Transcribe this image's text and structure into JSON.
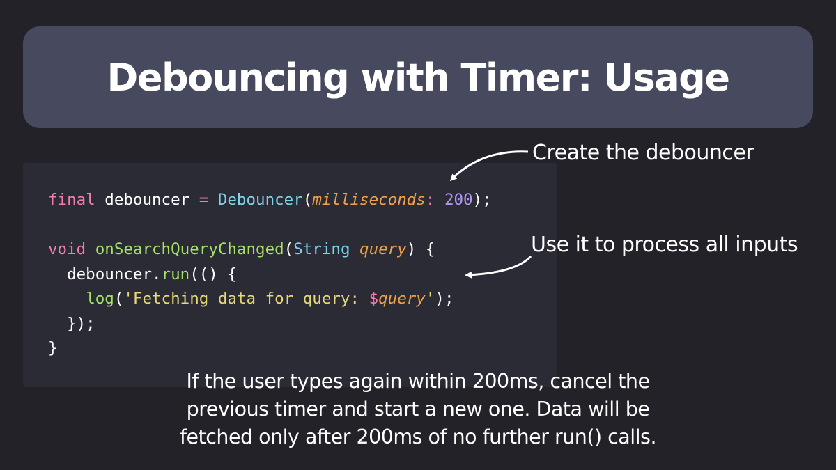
{
  "title": "Debouncing with Timer: Usage",
  "code": {
    "line1": {
      "kw_final": "final",
      "var": " debouncer ",
      "eq": "=",
      "sp": " ",
      "class": "Debouncer",
      "open": "(",
      "param": "milliseconds",
      "colon": ":",
      "sp2": " ",
      "num": "200",
      "close": ");"
    },
    "line3": {
      "kw_void": "void",
      "sp": " ",
      "fname": "onSearchQueryChanged",
      "open": "(",
      "type": "String",
      "sp2": " ",
      "param": "query",
      "close": ") {"
    },
    "line4": {
      "indent": "  ",
      "obj": "debouncer.",
      "method": "run",
      "rest": "(() {"
    },
    "line5": {
      "indent": "    ",
      "fn": "log",
      "open": "(",
      "str1": "'Fetching data for query: ",
      "dollar": "$",
      "param": "query",
      "str2": "'",
      "close": ");"
    },
    "line6": "  });",
    "line7": "}"
  },
  "callouts": {
    "create": "Create the debouncer",
    "use": "Use it to process all inputs"
  },
  "caption": {
    "line1": "If the user types again within 200ms, cancel the",
    "line2": "previous timer and start a new one. Data will be",
    "line3": "fetched only after 200ms of no further run() calls."
  },
  "colors": {
    "background": "#222228",
    "title_bar": "#474a5e",
    "code_panel": "#2a2b34",
    "keyword": "#f47fa8",
    "function": "#7dd3e8",
    "method": "#a6e267",
    "parameter": "#f0a04b",
    "number": "#b294f5",
    "string": "#e6d878"
  }
}
